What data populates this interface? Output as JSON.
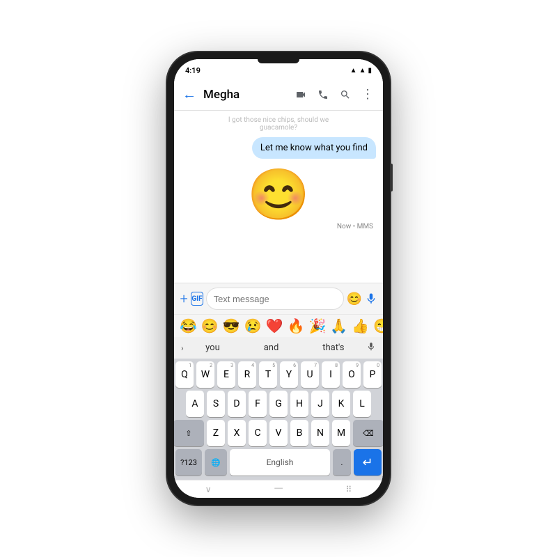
{
  "phone": {
    "status_time": "4:19",
    "status_wifi": "▲",
    "status_signal": "▲",
    "status_battery": "🔋"
  },
  "header": {
    "back_label": "←",
    "title": "Megha",
    "icon_video": "📹",
    "icon_phone": "📞",
    "icon_search": "🔍",
    "icon_more": "⋮"
  },
  "messages": {
    "top_snippet": "I got those nice chips, should we guacamole?",
    "bubble_text": "Let me know what you find",
    "emoji_message": "😊",
    "mms_time": "Now • MMS"
  },
  "input": {
    "placeholder": "Text message",
    "add_icon": "+",
    "gif_icon": "GIF",
    "emoji_icon": "😊",
    "mic_icon": "🎤"
  },
  "emoji_row": [
    "😂",
    "😊",
    "😎",
    "😢",
    "❤️",
    "🔥",
    "🎉",
    "🙏",
    "👍",
    "😁"
  ],
  "word_suggestions": [
    "you",
    "and",
    "that's"
  ],
  "keyboard": {
    "row1": [
      "Q",
      "W",
      "E",
      "R",
      "T",
      "Y",
      "U",
      "I",
      "O",
      "P"
    ],
    "row1_nums": [
      "1",
      "2",
      "3",
      "4",
      "5",
      "6",
      "7",
      "8",
      "9",
      "0"
    ],
    "row2": [
      "A",
      "S",
      "D",
      "F",
      "G",
      "H",
      "J",
      "K",
      "L"
    ],
    "row3": [
      "Z",
      "X",
      "C",
      "V",
      "B",
      "N",
      "M"
    ],
    "special_left": "⇧",
    "special_right": "⌫",
    "bottom_left": "?123",
    "bottom_emoji": "🌐",
    "bottom_space": "English",
    "bottom_period": ".",
    "bottom_enter": "↵"
  },
  "bottom_bar": {
    "chevron": "∨",
    "pill": "—",
    "grid": "⠿"
  }
}
